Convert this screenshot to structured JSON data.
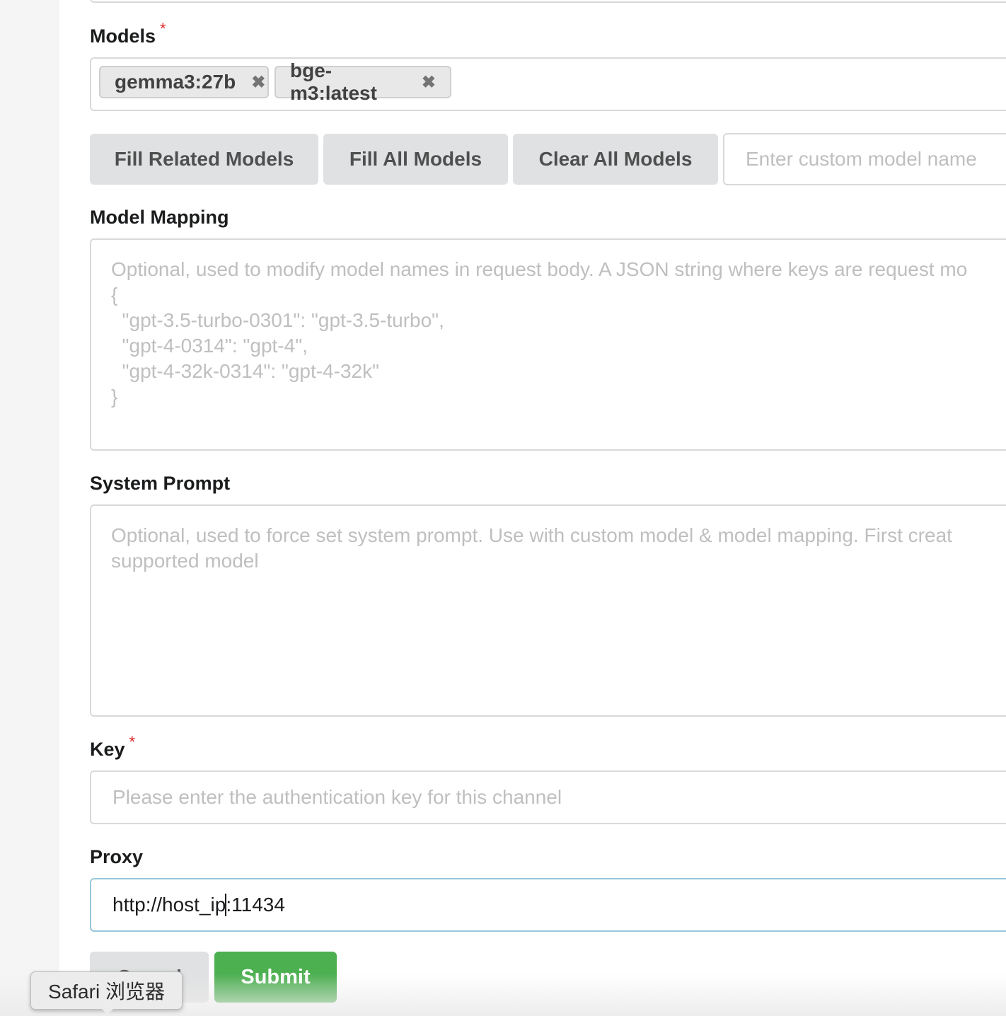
{
  "models": {
    "label": "Models",
    "required_mark": "*",
    "chips": [
      "gemma3:27b",
      "bge-m3:latest"
    ],
    "remove_glyph": "✖",
    "buttons": {
      "fill_related": "Fill Related Models",
      "fill_all": "Fill All Models",
      "clear_all": "Clear All Models"
    },
    "custom_placeholder": "Enter custom model name"
  },
  "model_mapping": {
    "label": "Model Mapping",
    "placeholder": "Optional, used to modify model names in request body. A JSON string where keys are request mo\n{\n  \"gpt-3.5-turbo-0301\": \"gpt-3.5-turbo\",\n  \"gpt-4-0314\": \"gpt-4\",\n  \"gpt-4-32k-0314\": \"gpt-4-32k\"\n}"
  },
  "system_prompt": {
    "label": "System Prompt",
    "placeholder": "Optional, used to force set system prompt. Use with custom model & model mapping. First creat\nsupported model"
  },
  "key": {
    "label": "Key",
    "required_mark": "*",
    "placeholder": "Please enter the authentication key for this channel"
  },
  "proxy": {
    "label": "Proxy",
    "value_before_caret": "http://host_ip",
    "value_after_caret": ":11434"
  },
  "actions": {
    "cancel": "Cancel",
    "submit": "Submit"
  },
  "tooltip": {
    "text": "Safari 浏览器"
  }
}
